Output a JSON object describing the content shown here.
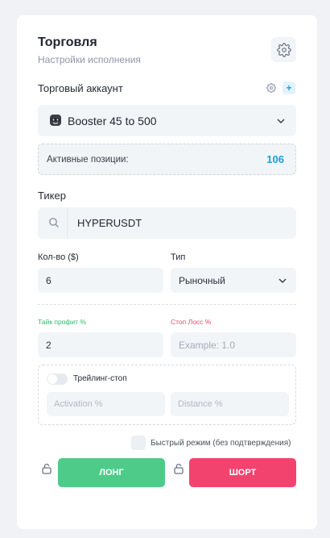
{
  "header": {
    "title": "Торговля",
    "subtitle": "Настройки исполнения"
  },
  "account": {
    "label": "Торговый аккаунт",
    "add_label": "+",
    "selected": "Booster 45 to 500"
  },
  "positions": {
    "label": "Активные позиции:",
    "count": "106"
  },
  "ticker": {
    "label": "Тикер",
    "value": "HYPERUSDT"
  },
  "order": {
    "qty_label": "Кол-во ($)",
    "qty_value": "6",
    "type_label": "Тип",
    "type_value": "Рыночный"
  },
  "risk": {
    "tp_label": "Тайк профит %",
    "tp_value": "2",
    "sl_label": "Стоп Лосс %",
    "sl_placeholder": "Example: 1.0"
  },
  "trailing": {
    "label": "Трейлинг-стоп",
    "activation_placeholder": "Activation %",
    "distance_placeholder": "Distance %"
  },
  "fast_mode": {
    "label": "Быстрый режим (без подтверждения)"
  },
  "actions": {
    "long_label": "ЛОНГ",
    "short_label": "ШОРТ"
  },
  "colors": {
    "accent": "#1aa0d8",
    "long": "#4ecb89",
    "short": "#f2426e",
    "take_profit": "#2dbb6a",
    "stop_loss": "#e84a6f"
  },
  "icons": [
    "settings-icon",
    "small-settings-icon",
    "mask-emoji-icon",
    "chevron-down-icon",
    "search-icon",
    "lock-icon"
  ]
}
